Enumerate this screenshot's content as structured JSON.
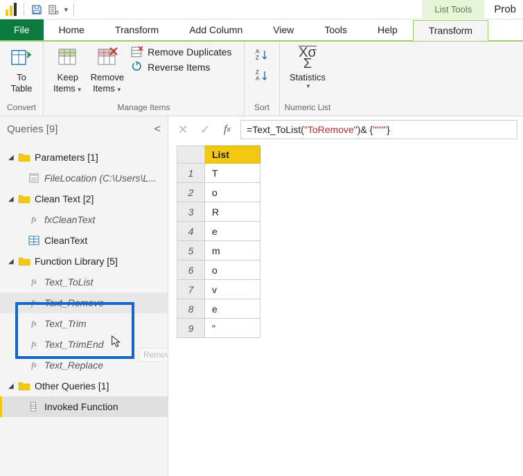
{
  "titlebar": {
    "context_tab": "List Tools",
    "right_text": "Prob"
  },
  "tabs": {
    "file": "File",
    "home": "Home",
    "transform": "Transform",
    "add_column": "Add Column",
    "view": "View",
    "tools": "Tools",
    "help": "Help",
    "list_transform": "Transform"
  },
  "ribbon": {
    "convert": {
      "to_table_1": "To",
      "to_table_2": "Table",
      "group": "Convert"
    },
    "manage": {
      "keep_1": "Keep",
      "keep_2": "Items",
      "remove_1": "Remove",
      "remove_2": "Items",
      "remove_dup": "Remove Duplicates",
      "reverse": "Reverse Items",
      "group": "Manage Items"
    },
    "sort": {
      "group": "Sort"
    },
    "numeric": {
      "stats": "Statistics",
      "group": "Numeric List"
    }
  },
  "queries": {
    "title": "Queries [9]",
    "groups": [
      {
        "label": "Parameters [1]",
        "items": [
          {
            "label": "FileLocation (C:\\Users\\L...",
            "icon": "param"
          }
        ]
      },
      {
        "label": "Clean Text [2]",
        "items": [
          {
            "label": "fxCleanText",
            "icon": "fx"
          },
          {
            "label": "CleanText",
            "icon": "table"
          }
        ]
      },
      {
        "label": "Function Library [5]",
        "items": [
          {
            "label": "Text_ToList",
            "icon": "fx"
          },
          {
            "label": "Text_Remove",
            "icon": "fx",
            "hover": true
          },
          {
            "label": "Text_Trim",
            "icon": "fx"
          },
          {
            "label": "Text_TrimEnd",
            "icon": "fx"
          },
          {
            "label": "Text_Replace",
            "icon": "fx"
          }
        ]
      },
      {
        "label": "Other Queries [1]",
        "items": [
          {
            "label": "Invoked Function",
            "icon": "list",
            "selected": true
          }
        ]
      }
    ]
  },
  "tooltip": "Remove",
  "formula": {
    "prefix": "= ",
    "fn": "Text_ToList",
    "open": "(",
    "arg": "\"ToRemove\"",
    "close": ")",
    "rest1": " & {",
    "rest2": "\"\"\"\"",
    "rest3": "}"
  },
  "grid": {
    "header": "List",
    "rows": [
      "T",
      "o",
      "R",
      "e",
      "m",
      "o",
      "v",
      "e",
      "\""
    ]
  },
  "chart_data": {
    "type": "table",
    "columns": [
      "List"
    ],
    "rows": [
      [
        "T"
      ],
      [
        "o"
      ],
      [
        "R"
      ],
      [
        "e"
      ],
      [
        "m"
      ],
      [
        "o"
      ],
      [
        "v"
      ],
      [
        "e"
      ],
      [
        "\""
      ]
    ]
  }
}
